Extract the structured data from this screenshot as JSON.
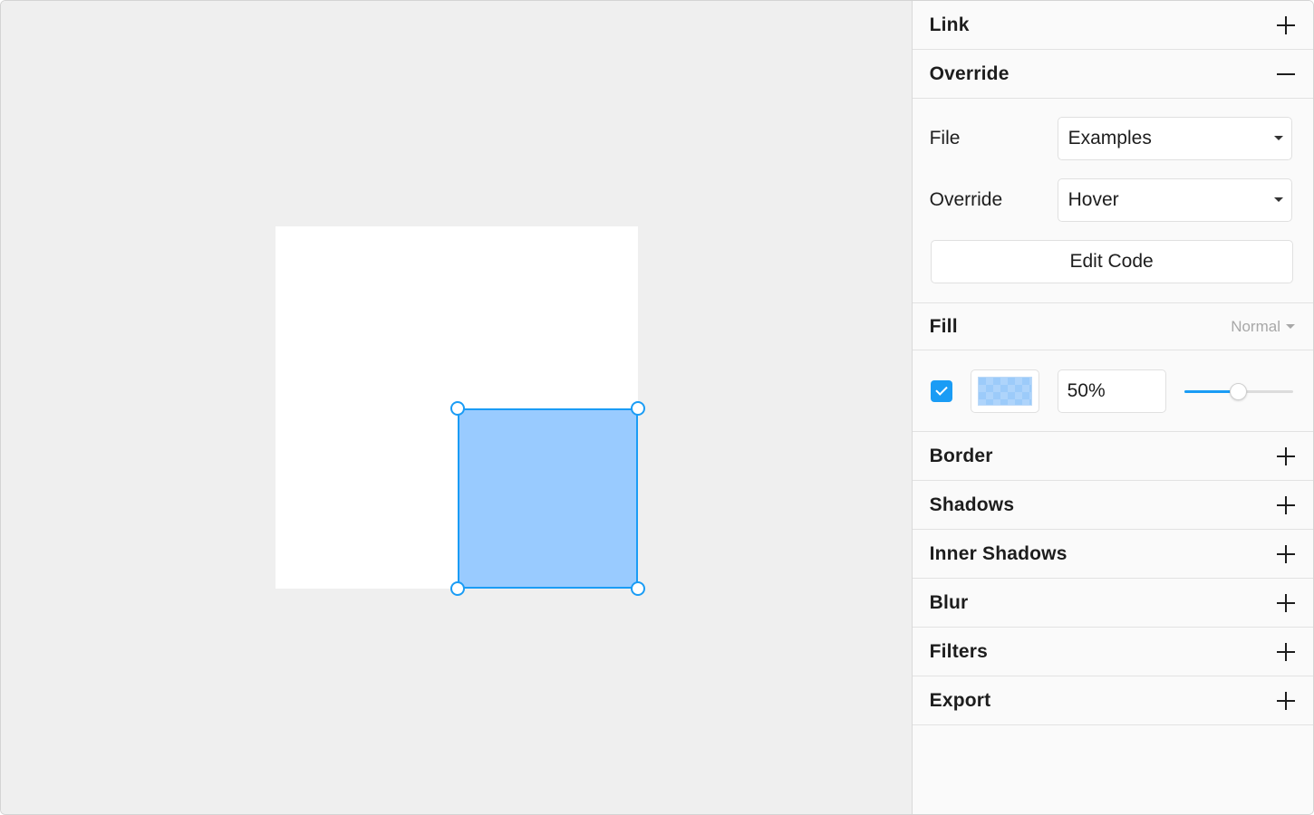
{
  "canvas": {
    "layer_fill": "#99cbff",
    "selection_color": "#1a9cf5"
  },
  "inspector": {
    "link": {
      "title": "Link",
      "icon": "plus-icon"
    },
    "override": {
      "title": "Override",
      "icon": "minus-icon",
      "file_label": "File",
      "file_value": "Examples",
      "override_label": "Override",
      "override_value": "Hover",
      "edit_code_label": "Edit Code"
    },
    "fill": {
      "title": "Fill",
      "blend_mode": "Normal",
      "enabled": true,
      "color": "#99cbff",
      "opacity_text": "50%",
      "opacity": 0.5
    },
    "sections": [
      {
        "title": "Border",
        "icon": "plus-icon"
      },
      {
        "title": "Shadows",
        "icon": "plus-icon"
      },
      {
        "title": "Inner Shadows",
        "icon": "plus-icon"
      },
      {
        "title": "Blur",
        "icon": "plus-icon"
      },
      {
        "title": "Filters",
        "icon": "plus-icon"
      },
      {
        "title": "Export",
        "icon": "plus-icon"
      }
    ]
  }
}
